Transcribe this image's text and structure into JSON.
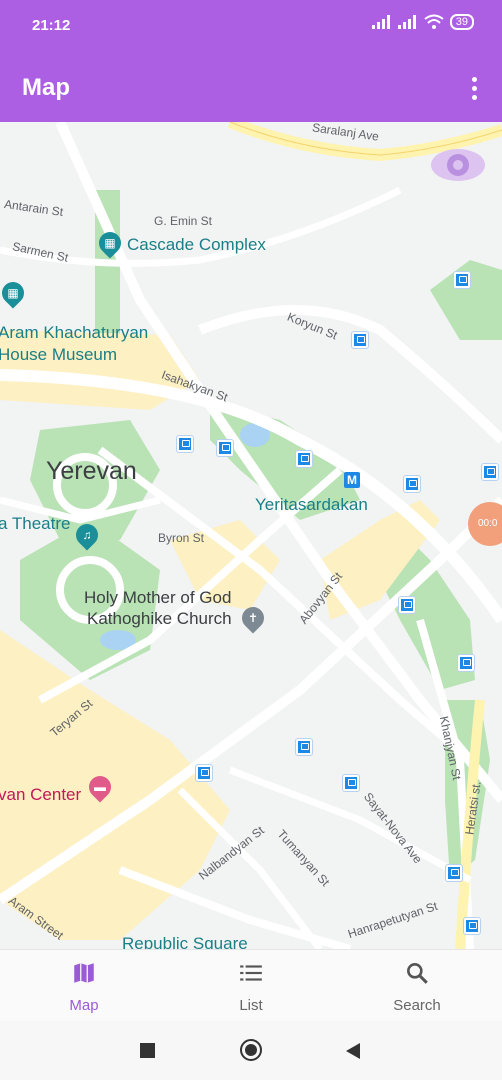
{
  "status_bar": {
    "time": "21:12",
    "battery": "39"
  },
  "app_bar": {
    "title": "Map"
  },
  "map": {
    "streets": [
      "Saralanj Ave",
      "Antarain St",
      "G. Emin St",
      "Sarmen St",
      "Koryun St",
      "Isahakyan St",
      "Byron St",
      "Abovyan St",
      "Teryan St",
      "Khanjyan St",
      "Heratsi st.",
      "Sayat-Nova Ave",
      "Nalbandyan St",
      "Tumanyan St",
      "Hanrapetutyan St",
      "Aram Street"
    ],
    "pois": {
      "cascade": "Cascade Complex",
      "museum_line1": "Aram Khachaturyan",
      "museum_line2": "House Museum",
      "yerevan": "Yerevan",
      "theatre": "a Theatre",
      "metro": "Yeritasardakan",
      "church_line1": "Holy Mother of God",
      "church_line2": "Kathoghike Church",
      "center": "van Center",
      "square": "Republic Square",
      "badge_text": "00:0"
    }
  },
  "bottom_nav": {
    "items": [
      {
        "label": "Map",
        "icon": "map-icon"
      },
      {
        "label": "List",
        "icon": "list-icon"
      },
      {
        "label": "Search",
        "icon": "search-icon"
      }
    ]
  },
  "colors": {
    "accent": "#ad5fe4",
    "active_nav": "#9b5bd6",
    "park": "#b9e2b5",
    "pedestrian": "#fdf0c2"
  }
}
